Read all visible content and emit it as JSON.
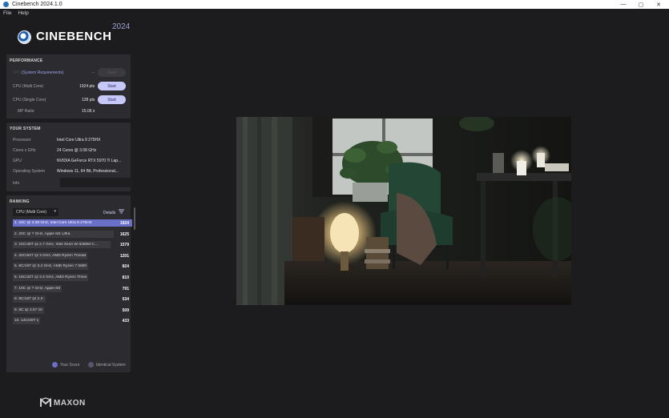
{
  "window": {
    "title": "Cinebench 2024.1.0",
    "controls": {
      "minimize": "—",
      "maximize": "▢",
      "close": "✕"
    }
  },
  "menu": {
    "items": [
      "File",
      "Help"
    ]
  },
  "logo": {
    "word": "CINEBENCH",
    "year": "2024"
  },
  "performance": {
    "title": "PERFORMANCE",
    "gpu": {
      "label": "GPU",
      "link": "(System Requirements)",
      "value": "–",
      "button": "Start"
    },
    "cpu_multi": {
      "label": "CPU (Multi Core)",
      "value": "1924 pts",
      "button": "Start"
    },
    "cpu_single": {
      "label": "CPU (Single Core)",
      "value": "128 pts",
      "button": "Start"
    },
    "mp_ratio": {
      "label": "MP Ratio",
      "value": "15.06 x"
    }
  },
  "system": {
    "title": "YOUR SYSTEM",
    "processor": {
      "label": "Processor",
      "value": "Intel Core Ultra 9 275HX"
    },
    "cores": {
      "label": "Cores x GHz",
      "value": "24 Cores @ 3.08 GHz"
    },
    "gpu": {
      "label": "GPU",
      "value": "NVIDIA GeForce RTX 5070 Ti Lap..."
    },
    "os": {
      "label": "Operating System",
      "value": "Windows 11, 64 Bit, Professional..."
    },
    "info": {
      "label": "Info",
      "value": ""
    }
  },
  "ranking": {
    "title": "RANKING",
    "dropdown": "CPU (Multi Core)",
    "details": "Details",
    "rows": [
      {
        "label": "1. 24C @ 3.08 GHz, Intel Core Ultra 9 275HX",
        "score": "1924",
        "mine": true,
        "fill": 1.0
      },
      {
        "label": "2. 20C @ ? GHz, Apple M1 Ultra",
        "score": "1625",
        "mine": false,
        "fill": 0.845
      },
      {
        "label": "3. 24C/48T @ 2.7 GHz, Intel Xeon W-3265M C...",
        "score": "1579",
        "mine": false,
        "fill": 0.821
      },
      {
        "label": "4. 32C/64T @ 3 GHz, AMD Ryzen Threadrippe...",
        "score": "1201",
        "mine": false,
        "fill": 0.624
      },
      {
        "label": "5. 8C/16T @ 3.4 GHz, AMD Ryzen 7 5800X 8-Co...",
        "score": "824",
        "mine": false,
        "fill": 0.628
      },
      {
        "label": "6. 16C/32T @ 3.4 GHz, AMD Ryzen Threadrippe...",
        "score": "810",
        "mine": false,
        "fill": 0.628
      },
      {
        "label": "7. 10C @ ? GHz, Apple M1 Max",
        "score": "791",
        "mine": false,
        "fill": 0.411
      },
      {
        "label": "8. 8C/16T @ 2.3 GHz, Intel Core i9-9880H CPU",
        "score": "534",
        "mine": false,
        "fill": 0.277
      },
      {
        "label": "9. 8C @ 2.5? GHz, Apple M1",
        "score": "509",
        "mine": false,
        "fill": 0.264
      },
      {
        "label": "10. 14C/20T @ 2 GHz, 12th Gen Intel Core i7-12...",
        "score": "433",
        "mine": false,
        "fill": 0.225
      }
    ],
    "legend": {
      "your_score": "Your Score",
      "identical": "Identical System"
    }
  },
  "brand": {
    "maxon": "MAXON"
  },
  "colors": {
    "accent": "#6a6fc8",
    "button": "#c6c9f8",
    "panel": "#2c2c30",
    "background": "#1c1c1e"
  }
}
